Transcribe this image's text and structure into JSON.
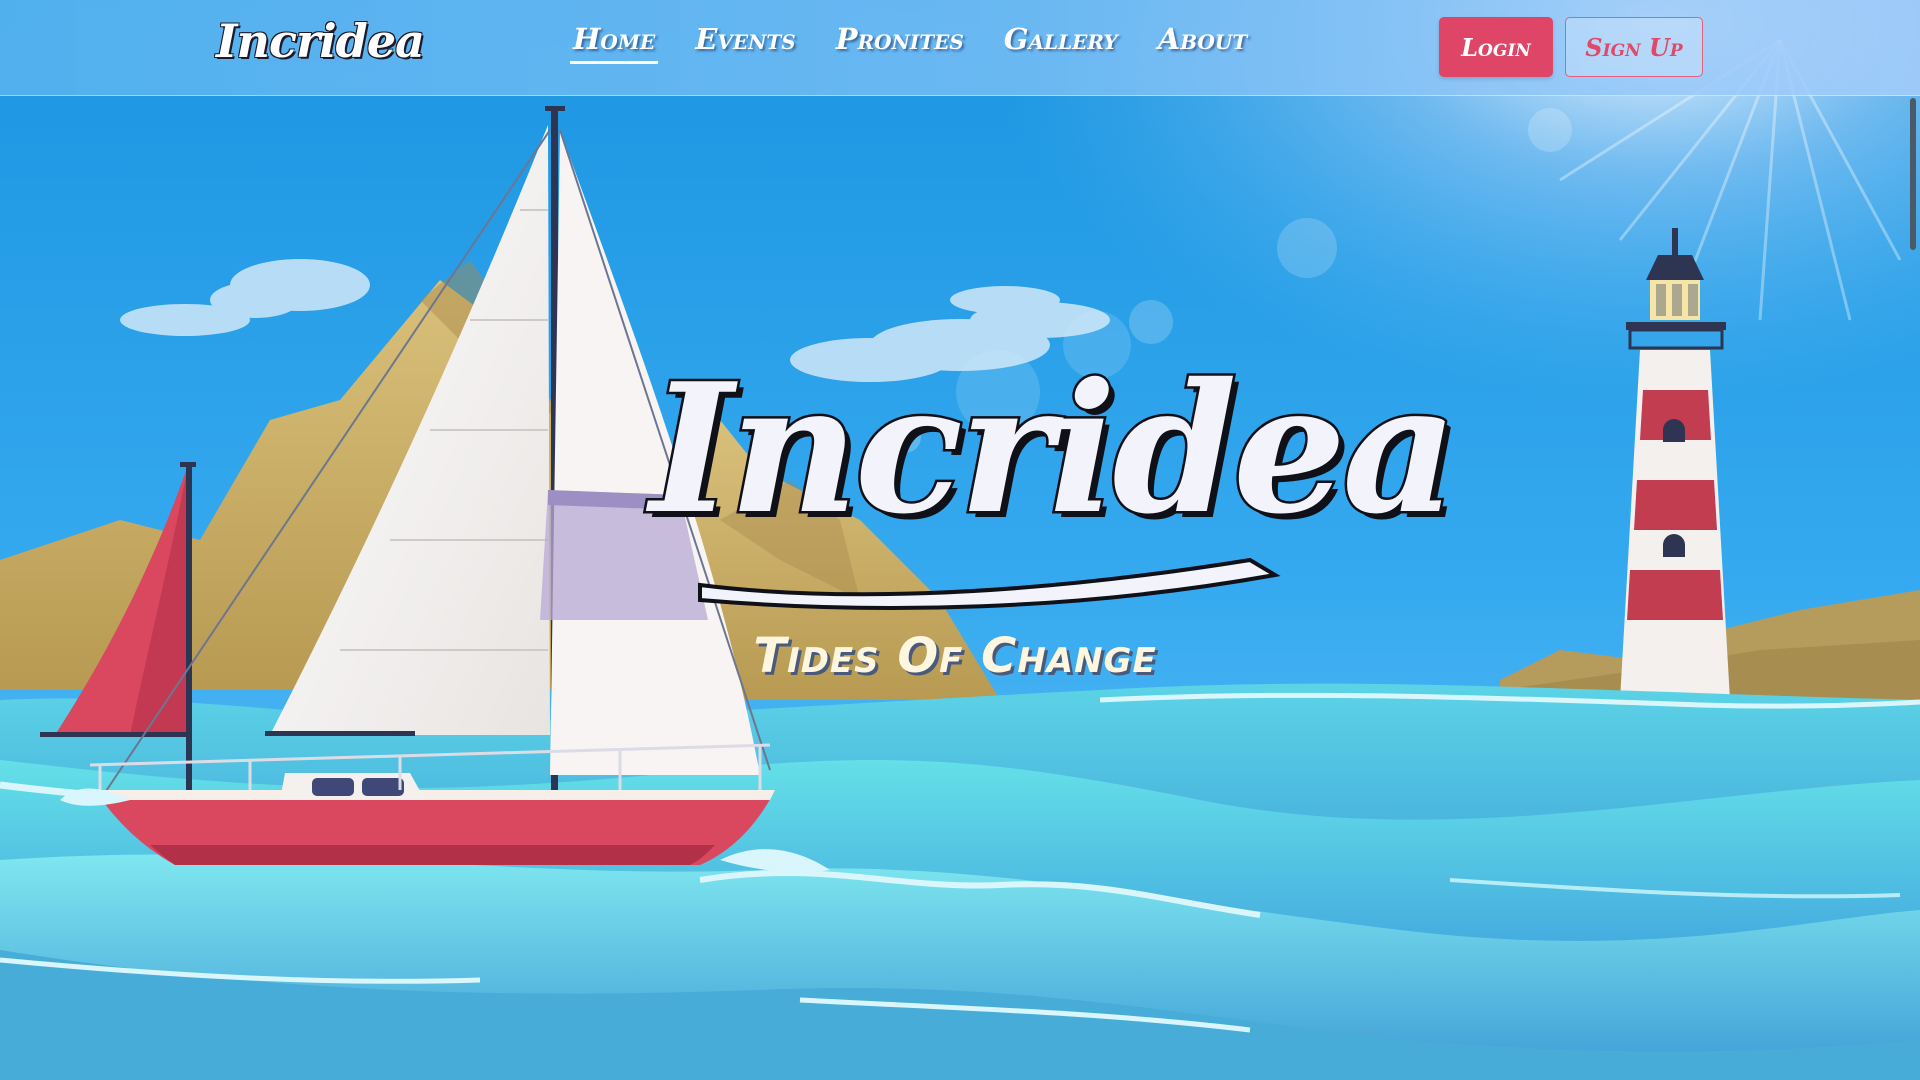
{
  "header": {
    "brand": "Incridea",
    "nav": [
      {
        "label": "Home",
        "active": true
      },
      {
        "label": "Events",
        "active": false
      },
      {
        "label": "Pronites",
        "active": false
      },
      {
        "label": "Gallery",
        "active": false
      },
      {
        "label": "About",
        "active": false
      }
    ],
    "login_label": "Login",
    "signup_label": "Sign Up"
  },
  "hero": {
    "title": "Incridea",
    "subtitle": "Tides Of Change"
  },
  "colors": {
    "sky": "#1e8fd8",
    "login_button": "#de4566",
    "signup_border": "#e85c7c",
    "sail_red": "#d9485e",
    "lighthouse_red": "#c23d4f",
    "sea": "#3fb5d9"
  }
}
